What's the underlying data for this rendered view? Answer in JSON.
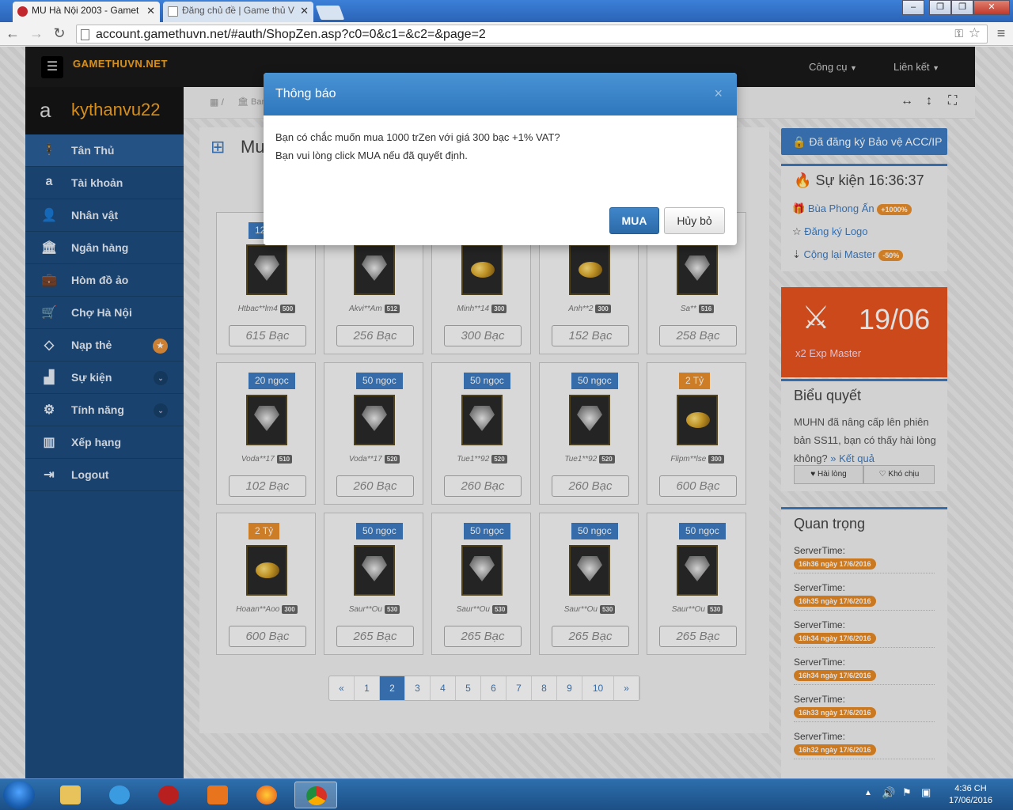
{
  "browser": {
    "tabs": [
      {
        "title": "MU Hà Nội 2003 - Gamet"
      },
      {
        "title": "Đăng chủ đề | Game thủ V"
      }
    ],
    "url": "account.gamethuvn.net/#auth/ShopZen.asp?c0=0&c1=&c2=&page=2",
    "window_buttons": [
      "–",
      "❐",
      "✕"
    ]
  },
  "header": {
    "logo": "GAMETHUVN.NET",
    "logo_big": "MU",
    "menu": [
      {
        "label": "Công cụ"
      },
      {
        "label": "Liên kết"
      }
    ]
  },
  "user": {
    "name": "kythanvu22"
  },
  "sidebar": {
    "items": [
      {
        "label": "Tân Thủ",
        "icon": "person-icon"
      },
      {
        "label": "Tài khoản",
        "icon": "amazon-icon"
      },
      {
        "label": "Nhân vật",
        "icon": "user-icon"
      },
      {
        "label": "Ngân hàng",
        "icon": "bank-icon"
      },
      {
        "label": "Hòm đồ ảo",
        "icon": "briefcase-icon"
      },
      {
        "label": "Chợ Hà Nội",
        "icon": "cart-icon"
      },
      {
        "label": "Nạp thẻ",
        "icon": "diamond-icon"
      },
      {
        "label": "Sự kiện",
        "icon": "android-icon"
      },
      {
        "label": "Tính năng",
        "icon": "cogs-icon"
      },
      {
        "label": "Xếp hạng",
        "icon": "chart-icon"
      },
      {
        "label": "Logout",
        "icon": "logout-icon"
      }
    ]
  },
  "breadcrumb": {
    "partial": "Bar"
  },
  "shop": {
    "title_partial": "Mu",
    "items": [
      {
        "tag": "123",
        "kind": "diamond",
        "seller": "Htbac**lm4",
        "lvl": "500",
        "price": "615 Bạc"
      },
      {
        "tag": "",
        "kind": "diamond",
        "seller": "Akvi**Am",
        "lvl": "512",
        "price": "256 Bạc"
      },
      {
        "tag": "",
        "kind": "coin",
        "seller": "Minh**14",
        "lvl": "300",
        "price": "300 Bạc"
      },
      {
        "tag": "",
        "kind": "coin",
        "seller": "Anh**2",
        "lvl": "300",
        "price": "152 Bạc"
      },
      {
        "tag": "",
        "kind": "diamond",
        "seller": "Sa**",
        "lvl": "516",
        "price": "258 Bạc"
      },
      {
        "tag": "20 ngọc",
        "kind": "diamond",
        "seller": "Voda**17",
        "lvl": "510",
        "price": "102 Bạc"
      },
      {
        "tag": "50 ngọc",
        "kind": "diamond",
        "seller": "Voda**17",
        "lvl": "520",
        "price": "260 Bạc"
      },
      {
        "tag": "50 ngọc",
        "kind": "diamond",
        "seller": "Tue1**92",
        "lvl": "520",
        "price": "260 Bạc"
      },
      {
        "tag": "50 ngọc",
        "kind": "diamond",
        "seller": "Tue1**92",
        "lvl": "520",
        "price": "260 Bạc"
      },
      {
        "tag": "2 Tỷ",
        "kind": "coin",
        "seller": "Flipm**lse",
        "lvl": "300",
        "price": "600 Bạc"
      },
      {
        "tag": "2 Tỷ",
        "kind": "coin",
        "seller": "Hoaan**Aoo",
        "lvl": "300",
        "price": "600 Bạc"
      },
      {
        "tag": "50 ngọc",
        "kind": "diamond",
        "seller": "Saur**Ou",
        "lvl": "530",
        "price": "265 Bạc"
      },
      {
        "tag": "50 ngọc",
        "kind": "diamond",
        "seller": "Saur**Ou",
        "lvl": "530",
        "price": "265 Bạc"
      },
      {
        "tag": "50 ngọc",
        "kind": "diamond",
        "seller": "Saur**Ou",
        "lvl": "530",
        "price": "265 Bạc"
      },
      {
        "tag": "50 ngọc",
        "kind": "diamond",
        "seller": "Saur**Ou",
        "lvl": "530",
        "price": "265 Bạc"
      }
    ]
  },
  "pagination": {
    "prev": "«",
    "next": "»",
    "pages": [
      "1",
      "2",
      "3",
      "4",
      "5",
      "6",
      "7",
      "8",
      "9",
      "10"
    ],
    "current": "2"
  },
  "right": {
    "register_btn": "Đã đăng ký Bảo vệ ACC/IP",
    "event_title": "Sự kiện 16:36:37",
    "events": [
      {
        "label": "Bùa Phong Ấn",
        "badge": "+1000%"
      },
      {
        "label": "Đăng ký Logo",
        "badge": ""
      },
      {
        "label": "Cộng lại Master",
        "badge": "-50%"
      }
    ],
    "promo": {
      "date": "19/06",
      "text": "x2 Exp Master"
    },
    "poll": {
      "title": "Biểu quyết",
      "text": "MUHN đã nâng cấp lên phiên bản SS11, bạn có thấy hài lòng không?",
      "result_link": "» Kết quả",
      "yes": "Hài lòng",
      "no": "Khó chịu"
    },
    "important": {
      "title": "Quan trọng",
      "label": "ServerTime:",
      "times": [
        "16h36 ngày 17/6/2016",
        "16h35 ngày 17/6/2016",
        "16h34 ngày 17/6/2016",
        "16h34 ngày 17/6/2016",
        "16h33 ngày 17/6/2016",
        "16h32 ngày 17/6/2016"
      ]
    }
  },
  "modal": {
    "title": "Thông báo",
    "close": "×",
    "line1": "Bạn có chắc muốn mua 1000 trZen với giá 300 bạc +1% VAT?",
    "line2": "Bạn vui lòng click MUA nếu đã quyết định.",
    "buy": "MUA",
    "cancel": "Hủy bỏ"
  },
  "taskbar": {
    "time": "4:36 CH",
    "date": "17/06/2016"
  },
  "colors": {
    "primary": "#3d7cc1",
    "sidebar": "#1e4c7e",
    "accent": "#ea8f2b",
    "promo": "#e8541f"
  }
}
